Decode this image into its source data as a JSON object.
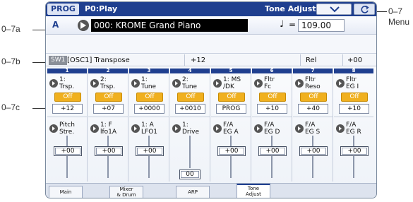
{
  "callouts": {
    "a": "0–7a",
    "b": "0–7b",
    "c": "0–7c",
    "menu_num": "0–7",
    "menu_word": "Menu"
  },
  "header": {
    "mode": "PROG",
    "program_title": "P0:Play",
    "page_title": "Tone Adjust"
  },
  "program": {
    "bank": "A",
    "name": "000: KROME Grand Piano",
    "tempo_symbol": "♩",
    "tempo_eq": "=",
    "tempo": "109.00"
  },
  "switch_info": {
    "badge": "SW1",
    "parameter": "[OSC1] Transpose",
    "value": "+12",
    "mode": "Rel",
    "int": "+00"
  },
  "strips": [
    {
      "num": "1",
      "top_label": "1:\nTrsp.",
      "switch": "Off",
      "top_value": "+12",
      "bottom_label": "Pitch\nStre.",
      "bottom_value": "+00"
    },
    {
      "num": "2",
      "top_label": "2:\nTrsp.",
      "switch": "Off",
      "top_value": "+07",
      "bottom_label": "1: F\nlfo1A",
      "bottom_value": "+00"
    },
    {
      "num": "3",
      "top_label": "1:\nTune",
      "switch": "Off",
      "top_value": "+0000",
      "bottom_label": "1: A\nLFO1",
      "bottom_value": "+00"
    },
    {
      "num": "4",
      "top_label": "2:\nTune",
      "switch": "Off",
      "top_value": "+0010",
      "bottom_label": "1:\nDrive",
      "bottom_value": "00"
    },
    {
      "num": "5",
      "top_label": "1: MS\n/DK",
      "switch": "Off",
      "top_value": "PROG",
      "bottom_label": "F/A\nEG A",
      "bottom_value": "+00"
    },
    {
      "num": "6",
      "top_label": "Fltr\nFc",
      "switch": "Off",
      "top_value": "+10",
      "bottom_label": "F/A\nEG D",
      "bottom_value": "+00"
    },
    {
      "num": "7",
      "top_label": "Fltr\nReso",
      "switch": "Off",
      "top_value": "+40",
      "bottom_label": "F/A\nEG S",
      "bottom_value": "+00"
    },
    {
      "num": "8",
      "top_label": "Fltr\nEG I",
      "switch": "Off",
      "top_value": "+10",
      "bottom_label": "F/A\nEG R",
      "bottom_value": "+00"
    }
  ],
  "tabs": [
    "Main",
    "Mixer\n& Drum",
    "ARP",
    "Tone\nAdjust"
  ],
  "active_tab": "Tone\nAdjust",
  "icons": {
    "menu": "chevron-down-icon",
    "write": "refresh-icon",
    "program_select": "play-arrow-icon"
  }
}
